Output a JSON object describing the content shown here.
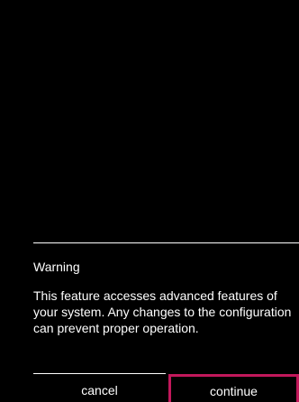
{
  "dialog": {
    "title": "Warning",
    "message": "This feature accesses advanced features of your system. Any changes to the configuration can prevent proper operation.",
    "cancel_label": "cancel",
    "continue_label": "continue",
    "focus_color": "#c2185b"
  }
}
